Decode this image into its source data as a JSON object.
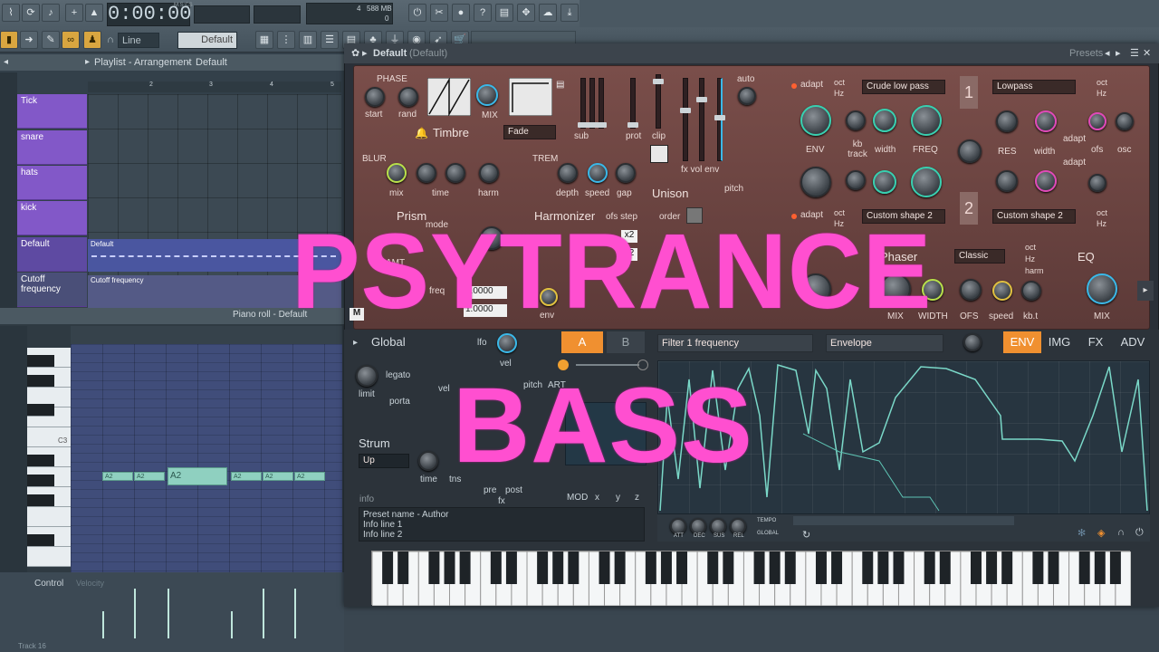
{
  "toolbar": {
    "time": "0:00:00",
    "time_unit": "M:S:CS",
    "pattern_num": "4",
    "memory": "588 MB",
    "memory_sub": "0",
    "snap_label": "Line",
    "preset_field": "Default"
  },
  "playlist": {
    "title": "Playlist - Arrangement",
    "pattern": "Default",
    "bars": [
      "2",
      "3",
      "4",
      "5"
    ],
    "tracks": [
      "Tick",
      "snare",
      "hats",
      "kick",
      "Default",
      "Cutoff frequency"
    ],
    "clip_default": "Default",
    "clip_cutoff": "Cutoff frequency"
  },
  "pianoroll": {
    "title": "Piano roll - Default",
    "c3_label": "C3",
    "notes": [
      "A2",
      "A2",
      "A2",
      "A2",
      "A2",
      "A2"
    ],
    "control_label": "Control",
    "velocity_label": "Velocity",
    "track_label": "Track 16"
  },
  "synth": {
    "title": "Default",
    "title_sub": "(Default)",
    "presets_label": "Presets",
    "phase_label": "PHASE",
    "start_label": "start",
    "rand_label": "rand",
    "mix_label": "MIX",
    "timbre_label": "Timbre",
    "fade_value": "Fade",
    "sub_label": "sub",
    "prot_label": "prot",
    "clip_label": "clip",
    "auto_label": "auto",
    "fx_vol_env": "fx vol env",
    "blur_label": "BLUR",
    "blur_mix": "mix",
    "blur_time": "time",
    "blur_harm": "harm",
    "trem_label": "TREM",
    "trem_depth": "depth",
    "trem_speed": "speed",
    "trem_gap": "gap",
    "unison_label": "Unison",
    "order_label": "order",
    "pitch_label": "pitch",
    "prism_label": "Prism",
    "harmonizer_label": "Harmonizer",
    "ofs_step": "ofs step",
    "mode_label": "mode",
    "amt_label": "AMT",
    "freq_label": "freq",
    "env_label": "env",
    "x2_a": "x2",
    "x2_b": "x2",
    "num_a": "1.0000",
    "num_b": "1.0000",
    "filter1_type": "Crude low pass",
    "filter1_b": "Lowpass",
    "filter2_type": "Custom shape 2",
    "filter2_b": "Custom shape 2",
    "adapt": "adapt",
    "oct": "oct",
    "hz": "Hz",
    "env_knob": "ENV",
    "kb_track": "kb track",
    "width": "width",
    "freq_knob": "FREQ",
    "res": "RES",
    "ofs": "ofs",
    "osc": "osc",
    "phaser_label": "Phaser",
    "phaser_mode": "Classic",
    "harm": "harm",
    "eq_label": "EQ",
    "fx_mix": "MIX",
    "fx_width": "WIDTH",
    "fx_ofs": "OFS",
    "fx_speed": "speed",
    "fx_kbt": "kb.t",
    "eq_mix": "MIX",
    "global_label": "Global",
    "lfo": "lfo",
    "vel": "vel",
    "legato": "legato",
    "porta": "porta",
    "limit": "limit",
    "pitch_small": "pitch",
    "art": "ART",
    "strum_label": "Strum",
    "strum_value": "Up",
    "time_label": "time",
    "tns_label": "tns",
    "pre": "pre",
    "post": "post",
    "fx": "fx",
    "mod": "MOD",
    "mod_x": "x",
    "mod_y": "y",
    "mod_z": "z",
    "tab_a": "A",
    "tab_b": "B",
    "target_param": "Filter 1 frequency",
    "target_mode": "Envelope",
    "tabs": [
      "ENV",
      "IMG",
      "FX",
      "ADV"
    ],
    "info_header": "info",
    "info_lines": [
      "Preset name - Author",
      "Info line 1",
      "Info line 2"
    ],
    "env_knobs": [
      "ATT",
      "DEC",
      "SUS",
      "REL"
    ],
    "tempo": "TEMPO",
    "global_small": "GLOBAL"
  },
  "overlay": {
    "line1": "PSYTRANCE",
    "line2": "BASS",
    "color": "#ff4fd0"
  }
}
